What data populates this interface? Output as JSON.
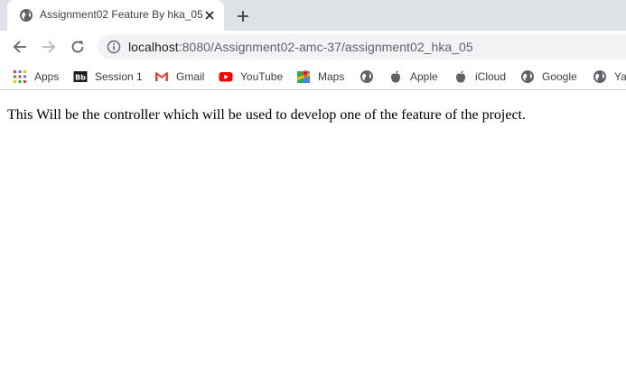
{
  "browser": {
    "tab": {
      "title": "Assignment02 Feature By hka_05"
    },
    "address": {
      "host": "localhost",
      "rest": ":8080/Assignment02-amc-37/assignment02_hka_05"
    },
    "bookmarks": [
      {
        "label": "Apps",
        "icon": "apps-grid-icon"
      },
      {
        "label": "Session 1",
        "icon": "blackboard-icon"
      },
      {
        "label": "Gmail",
        "icon": "gmail-icon"
      },
      {
        "label": "YouTube",
        "icon": "youtube-icon"
      },
      {
        "label": "Maps",
        "icon": "maps-icon"
      },
      {
        "label": "",
        "icon": "globe-icon"
      },
      {
        "label": "Apple",
        "icon": "apple-icon"
      },
      {
        "label": "iCloud",
        "icon": "apple-icon"
      },
      {
        "label": "Google",
        "icon": "globe-icon"
      },
      {
        "label": "Ya",
        "icon": "globe-icon"
      }
    ]
  },
  "page": {
    "text": "This Will be the controller which will be used to develop one of the feature of the project."
  }
}
